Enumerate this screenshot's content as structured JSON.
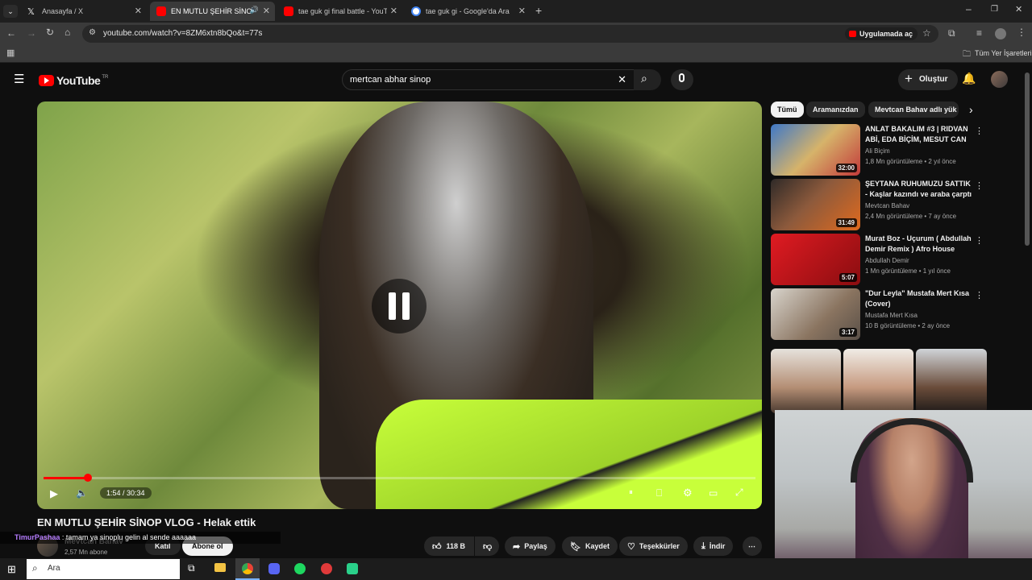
{
  "browser": {
    "tabs": [
      {
        "label": "Anasayfa / X",
        "color": "#000000"
      },
      {
        "label": "EN MUTLU ŞEHİR SİNOP VLOG",
        "color": "#ff0000"
      },
      {
        "label": "tae guk gi final battle - YouTube",
        "color": "#ff0000"
      },
      {
        "label": "tae guk gi - Google'da Ara",
        "color": "#4285f4"
      }
    ],
    "url": "youtube.com/watch?v=8ZM6xtn8bQo&t=77s",
    "open_in_app": "Uygulamada aç",
    "bookmarks_label": "Tüm Yer İşaretleri"
  },
  "youtube": {
    "logo": "YouTube",
    "region": "TR",
    "search_query": "mertcan abhar sinop",
    "create_label": "Oluştur",
    "chips": [
      "Tümü",
      "Aramanızdan",
      "Mevtcan Bahav adlı yük"
    ],
    "player": {
      "time": "1:54 / 30:34",
      "progress": 0.062
    },
    "video_title": "EN MUTLU ŞEHİR SİNOP VLOG - Helak ettik",
    "channel": {
      "name": "Mevtcan Bahav",
      "subs": "2,57 Mn abone",
      "join": "Katıl",
      "subscribe": "Abone ol"
    },
    "actions": {
      "likes": "118 B",
      "share": "Paylaş",
      "save": "Kaydet",
      "thanks": "Teşekkürler",
      "download": "İndir"
    },
    "recommendations": [
      {
        "title": "ANLAT BAKALIM #3 | RIDVAN ABİ, EDA BİÇİM, MESUT CAN ...",
        "channel": "Ali Biçim",
        "meta": "1,8 Mn görüntüleme • 2 yıl önce",
        "duration": "32:00"
      },
      {
        "title": "ŞEYTANA RUHUMUZU SATTIK - Kaşlar kazındı ve araba çarptı ...",
        "channel": "Mevtcan Bahav",
        "meta": "2,4 Mn görüntüleme • 7 ay önce",
        "duration": "31:49"
      },
      {
        "title": "Murat Boz - Uçurum ( Abdullah Demir Remix ) Afro House",
        "channel": "Abdullah Demir",
        "meta": "1 Mn görüntüleme • 1 yıl önce",
        "duration": "5:07"
      },
      {
        "title": "\"Dur Leyla\" Mustafa Mert Kısa (Cover)",
        "channel": "Mustafa Mert Kısa",
        "meta": "10 B görüntüleme • 2 ay önce",
        "duration": "3:17"
      }
    ]
  },
  "chat_overlay": {
    "user": "TimurPashaa",
    "message": "tamam ya sinoplu gelin al sende aaaaaa"
  },
  "taskbar": {
    "search_label": "Ara"
  }
}
